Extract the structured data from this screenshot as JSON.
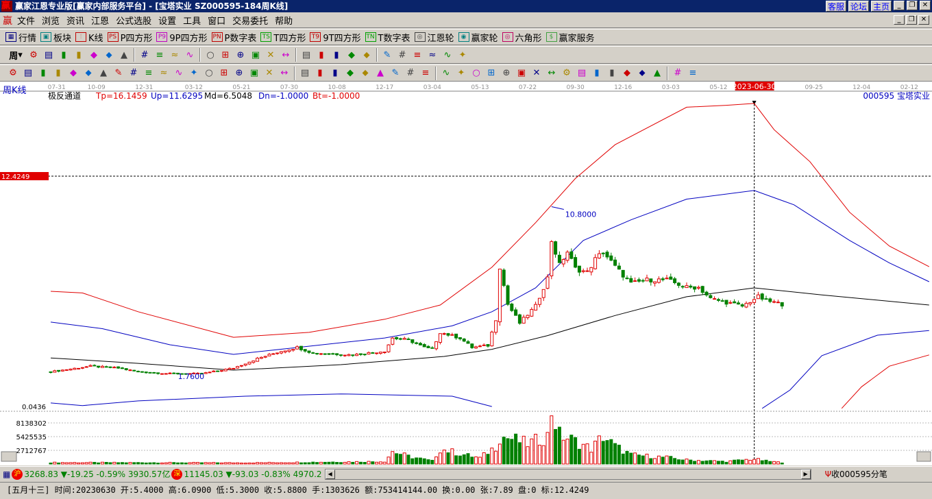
{
  "window": {
    "title": "赢家江恩专业版[赢家内部服务平台] - [宝塔实业   SZ000595-184周K线]",
    "logo": "赢",
    "links": [
      "客服",
      "论坛",
      "主页"
    ]
  },
  "menu": {
    "logo": "赢",
    "items": [
      "文件",
      "浏览",
      "资讯",
      "江恩",
      "公式选股",
      "设置",
      "工具",
      "窗口",
      "交易委托",
      "帮助"
    ]
  },
  "toolbar1": [
    {
      "icon": "quote-table-icon",
      "glyph": "▦",
      "label": "行情",
      "color": "#000080"
    },
    {
      "icon": "sector-icon",
      "glyph": "▣",
      "label": "板块",
      "color": "#008080"
    },
    {
      "icon": "kline-icon",
      "glyph": "⫶",
      "label": "K线",
      "color": "#c00000"
    },
    {
      "icon": "ps-icon",
      "glyph": "PS",
      "label": "P四方形",
      "color": "#c00000"
    },
    {
      "icon": "p9-icon",
      "glyph": "P9",
      "label": "9P四方形",
      "color": "#c000c0"
    },
    {
      "icon": "pn-icon",
      "glyph": "PN",
      "label": "P数字表",
      "color": "#c00000"
    },
    {
      "icon": "ts-icon",
      "glyph": "TS",
      "label": "T四方形",
      "color": "#00a000"
    },
    {
      "icon": "t9-icon",
      "glyph": "T9",
      "label": "9T四方形",
      "color": "#c00000"
    },
    {
      "icon": "tn-icon",
      "glyph": "TN",
      "label": "T数字表",
      "color": "#00a000"
    },
    {
      "icon": "gann-wheel-icon",
      "glyph": "◎",
      "label": "江恩轮",
      "color": "#404040"
    },
    {
      "icon": "winner-wheel-icon",
      "glyph": "◉",
      "label": "赢家轮",
      "color": "#008080"
    },
    {
      "icon": "hexagon-icon",
      "glyph": "◎",
      "label": "六角形",
      "color": "#c00060"
    },
    {
      "icon": "dollar-icon",
      "glyph": "$",
      "label": "赢家服务",
      "color": "#40a040"
    }
  ],
  "toolbar2": {
    "period": "周",
    "icons": [
      "settings-icon",
      "doc-icon",
      "bar-3-icon",
      "bar-9-icon",
      "candle-type-icon",
      "ji-icon",
      "color-chart-icon",
      "|",
      "first-icon",
      "last-icon",
      "left-icon",
      "right-icon",
      "|",
      "diamond-left-icon",
      "diamond-right-icon",
      "diamond-lr-icon",
      "diamond-x-icon",
      "diamond-star-icon",
      "diamond-ud-icon",
      "|",
      "hand-icon",
      "crosshair-icon",
      "zigzag-icon",
      "pattern-icon",
      "pattern2-icon",
      "|",
      "calendar-icon",
      "calculator-icon",
      "report-icon",
      "save-icon",
      "network-icon",
      "print-icon"
    ]
  },
  "toolbar3": {
    "icons": [
      "pen-icon",
      "grid-icon",
      "gold1-icon",
      "gold2-icon",
      "fib-icon",
      "spiral-icon",
      "pen2-icon",
      "circle-icon",
      "hash-icon",
      "n2-icon",
      "angle-icon",
      "target-icon",
      "star-icon",
      "square-icon",
      "lines-icon",
      "shen-icon",
      "ying-icon",
      "ruler-icon",
      "arrow-range-icon",
      "|",
      "box-icon",
      "fan-icon",
      "gann-box-icon",
      "gann-box2-icon",
      "angle2-icon",
      "v-icon",
      "grid2-icon",
      "grid3-icon",
      "parallel-icon",
      "|",
      "table-icon",
      "pct-icon",
      "percent-icon",
      "pct-line-icon",
      "gold-circle-icon",
      "gold-line-icon",
      "pen3-icon",
      "wave-icon",
      "gold-line2-icon",
      "fan2-icon",
      "f-fan-icon",
      "gold-fan-icon",
      "shen-fan-icon",
      "ying-fan-icon",
      "si-fan-icon",
      "|",
      "taiji-icon",
      "infinity-icon"
    ]
  },
  "chart": {
    "period_label": "周K线",
    "indicator": {
      "name": "极反通道",
      "tp": "Tp=16.1459",
      "up": "Up=11.6295",
      "md": "Md=6.5048",
      "dn": "Dn=-1.0000",
      "bt": "Bt=-1.0000"
    },
    "stock_label": "000595  宝塔实业",
    "cursor_price": "12.4249",
    "cursor_date": "2023-06-30",
    "peak_label": "10.8000",
    "low_label": "1.7600",
    "bottom_label": "0.0436",
    "vol_labels": [
      "8138302",
      "5425535",
      "2712767"
    ]
  },
  "chart_data": {
    "type": "candlestick",
    "title": "SZ000595-184周K线",
    "x_tick_labels": [
      "07-31",
      "10-09",
      "12-31",
      "03-12",
      "05-21",
      "07-30",
      "10-08",
      "12-17",
      "03-04",
      "05-13",
      "07-22",
      "09-30",
      "12-16",
      "03-03",
      "05-12",
      "2023-06-30",
      "09-25",
      "12-04",
      "02-12"
    ],
    "x_tick_index": [
      1.5,
      11.5,
      23.5,
      36,
      48,
      60,
      72,
      84,
      96,
      108,
      120,
      132,
      144,
      156,
      168,
      177,
      192,
      204,
      216
    ],
    "ylim": [
      0.0436,
      12.4249
    ],
    "candle_count": 185,
    "close_keypoints": [
      [
        0,
        2.0
      ],
      [
        10,
        2.3
      ],
      [
        17,
        2.2
      ],
      [
        22,
        2.0
      ],
      [
        30,
        1.9
      ],
      [
        38,
        1.9
      ],
      [
        46,
        2.2
      ],
      [
        52,
        2.7
      ],
      [
        58,
        3.1
      ],
      [
        62,
        3.3
      ],
      [
        66,
        3.0
      ],
      [
        76,
        2.9
      ],
      [
        84,
        3.1
      ],
      [
        86,
        3.8
      ],
      [
        90,
        3.7
      ],
      [
        94,
        3.3
      ],
      [
        96,
        3.2
      ],
      [
        98,
        4.1
      ],
      [
        103,
        3.8
      ],
      [
        106,
        3.3
      ],
      [
        110,
        3.4
      ],
      [
        112,
        4.8
      ],
      [
        113,
        7.6
      ],
      [
        115,
        5.6
      ],
      [
        118,
        4.6
      ],
      [
        122,
        5.5
      ],
      [
        125,
        7.0
      ],
      [
        126,
        9.0
      ],
      [
        128,
        7.7
      ],
      [
        130,
        8.4
      ],
      [
        132,
        7.5
      ],
      [
        135,
        7.3
      ],
      [
        137,
        8.0
      ],
      [
        139,
        8.4
      ],
      [
        142,
        7.6
      ],
      [
        146,
        6.7
      ],
      [
        150,
        6.9
      ],
      [
        155,
        6.9
      ],
      [
        160,
        6.5
      ],
      [
        163,
        6.5
      ],
      [
        166,
        5.9
      ],
      [
        170,
        5.7
      ],
      [
        174,
        5.5
      ],
      [
        177,
        5.88
      ],
      [
        178,
        6.0
      ],
      [
        180,
        5.8
      ],
      [
        184,
        5.6
      ]
    ],
    "series": [
      {
        "name": "Tp",
        "color": "#e00000",
        "points": [
          [
            0,
            6.29
          ],
          [
            8,
            6.2
          ],
          [
            22,
            5.2
          ],
          [
            46,
            3.84
          ],
          [
            65,
            4.1
          ],
          [
            84,
            4.8
          ],
          [
            98,
            5.56
          ],
          [
            111,
            7.57
          ],
          [
            122,
            9.95
          ],
          [
            132,
            12.3
          ],
          [
            142,
            14.1
          ],
          [
            160,
            16.1
          ],
          [
            170,
            16.2
          ],
          [
            177,
            16.3
          ],
          [
            182,
            14.9
          ],
          [
            191,
            13.2
          ],
          [
            201,
            10.5
          ],
          [
            211,
            8.7
          ],
          [
            221,
            7.6
          ]
        ]
      },
      {
        "name": "Up",
        "color": "#0000c0",
        "points": [
          [
            0,
            4.65
          ],
          [
            13,
            4.3
          ],
          [
            30,
            3.44
          ],
          [
            46,
            2.93
          ],
          [
            60,
            3.25
          ],
          [
            84,
            3.8
          ],
          [
            101,
            4.45
          ],
          [
            111,
            5.2
          ],
          [
            122,
            6.47
          ],
          [
            134,
            9.0
          ],
          [
            146,
            10.1
          ],
          [
            160,
            11.2
          ],
          [
            177,
            11.66
          ],
          [
            187,
            10.9
          ],
          [
            201,
            9.0
          ],
          [
            211,
            7.8
          ],
          [
            221,
            6.8
          ]
        ]
      },
      {
        "name": "Md",
        "color": "#000000",
        "points": [
          [
            0,
            2.74
          ],
          [
            22,
            2.45
          ],
          [
            46,
            2.09
          ],
          [
            73,
            2.38
          ],
          [
            99,
            2.82
          ],
          [
            111,
            3.2
          ],
          [
            125,
            3.93
          ],
          [
            142,
            5.0
          ],
          [
            160,
            6.0
          ],
          [
            177,
            6.47
          ],
          [
            194,
            6.1
          ],
          [
            221,
            5.56
          ]
        ]
      },
      {
        "name": "Dn",
        "color": "#0000c0",
        "points": [
          [
            0,
            0.34
          ],
          [
            8,
            0.2
          ],
          [
            22,
            0.45
          ],
          [
            49,
            0.7
          ],
          [
            73,
            0.82
          ],
          [
            101,
            0.7
          ],
          [
            111,
            0.15
          ]
        ],
        "points2": [
          [
            179,
            0.05
          ],
          [
            186,
            1.03
          ],
          [
            194,
            2.86
          ],
          [
            208,
            3.95
          ],
          [
            221,
            4.2
          ]
        ]
      },
      {
        "name": "Bt",
        "color": "#e00000",
        "points2": [
          [
            199,
            0.05
          ],
          [
            204,
            1.2
          ],
          [
            211,
            2.3
          ],
          [
            221,
            2.9
          ]
        ]
      }
    ],
    "volume": {
      "ylim": [
        0,
        10850000
      ],
      "keypoints": [
        [
          0,
          300000
        ],
        [
          50,
          250000
        ],
        [
          84,
          500000
        ],
        [
          86,
          2500000
        ],
        [
          90,
          1500000
        ],
        [
          96,
          600000
        ],
        [
          98,
          3000000
        ],
        [
          103,
          2000000
        ],
        [
          108,
          1200000
        ],
        [
          112,
          3500000
        ],
        [
          113,
          5500000
        ],
        [
          116,
          5000000
        ],
        [
          120,
          4000000
        ],
        [
          125,
          5500000
        ],
        [
          126,
          10800000
        ],
        [
          128,
          5800000
        ],
        [
          132,
          4500000
        ],
        [
          136,
          3000000
        ],
        [
          139,
          5500000
        ],
        [
          142,
          3500000
        ],
        [
          146,
          1800000
        ],
        [
          155,
          1300000
        ],
        [
          160,
          800000
        ],
        [
          170,
          500000
        ],
        [
          177,
          1000000
        ],
        [
          180,
          600000
        ],
        [
          184,
          300000
        ]
      ]
    }
  },
  "status1": {
    "sh_badge": "沪",
    "sh_index": "3268.83",
    "sh_chg": "▼-19.25",
    "sh_pct": "-0.59%",
    "sh_amt": "3930.57亿",
    "sz_badge": "深",
    "sz_index": "11145.03",
    "sz_chg": "▼-93.03",
    "sz_pct": "-0.83%",
    "sz_amt": "4970.2",
    "right_label": "收000595分笔"
  },
  "status2": {
    "text": "[五月十三] 时间:20230630 开:5.4000 高:6.0900 低:5.3000 收:5.8800 手:1303626 额:753414144.00 换:0.00 张:7.89 盘:0 标:12.4249"
  }
}
